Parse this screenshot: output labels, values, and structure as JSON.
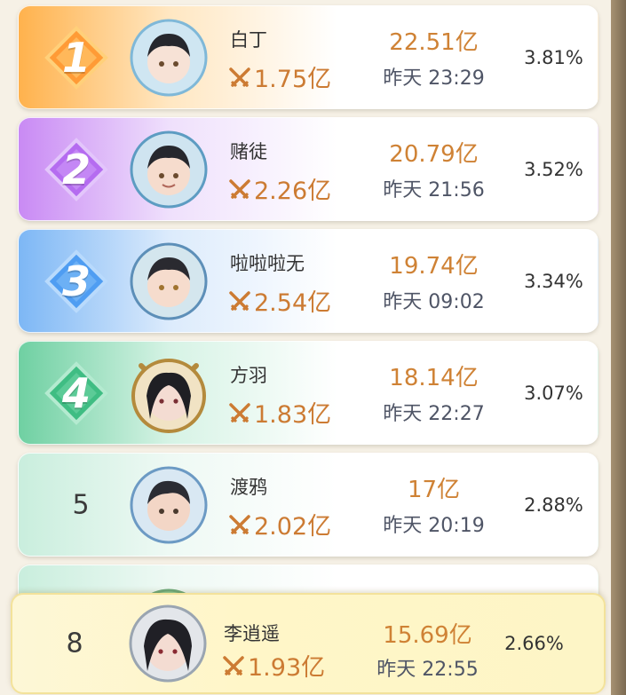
{
  "ranking": {
    "entries": [
      {
        "rank": "1",
        "name": "白丁",
        "power": "1.75亿",
        "score": "22.51亿",
        "time": "昨天 23:29",
        "percent": "3.81%",
        "badge_colors": [
          "#ff9b36",
          "#ffd07a"
        ]
      },
      {
        "rank": "2",
        "name": "赌徒",
        "power": "2.26亿",
        "score": "20.79亿",
        "time": "昨天 21:56",
        "percent": "3.52%",
        "badge_colors": [
          "#b56cf0",
          "#e3c6fb"
        ]
      },
      {
        "rank": "3",
        "name": "啦啦啦无",
        "power": "2.54亿",
        "score": "19.74亿",
        "time": "昨天 09:02",
        "percent": "3.34%",
        "badge_colors": [
          "#4f9df2",
          "#b9dafc"
        ]
      },
      {
        "rank": "4",
        "name": "方羽",
        "power": "1.83亿",
        "score": "18.14亿",
        "time": "昨天 22:27",
        "percent": "3.07%",
        "badge_colors": [
          "#3fbd83",
          "#b4ead0"
        ]
      },
      {
        "rank": "5",
        "name": "渡鸦",
        "power": "2.02亿",
        "score": "17亿",
        "time": "昨天 20:19",
        "percent": "2.88%",
        "badge_colors": [
          "#c2ead9",
          "#e6f7ef"
        ]
      }
    ],
    "user_entry": {
      "rank": "8",
      "name": "李逍遥",
      "power": "1.93亿",
      "score": "15.69亿",
      "time": "昨天 22:55",
      "percent": "2.66%"
    }
  },
  "icons": {
    "power": "crossed-swords-icon",
    "avatar": "character-portrait"
  },
  "colors": {
    "score": "#cf8235",
    "power": "#cc7b33",
    "time": "#4f5566"
  }
}
